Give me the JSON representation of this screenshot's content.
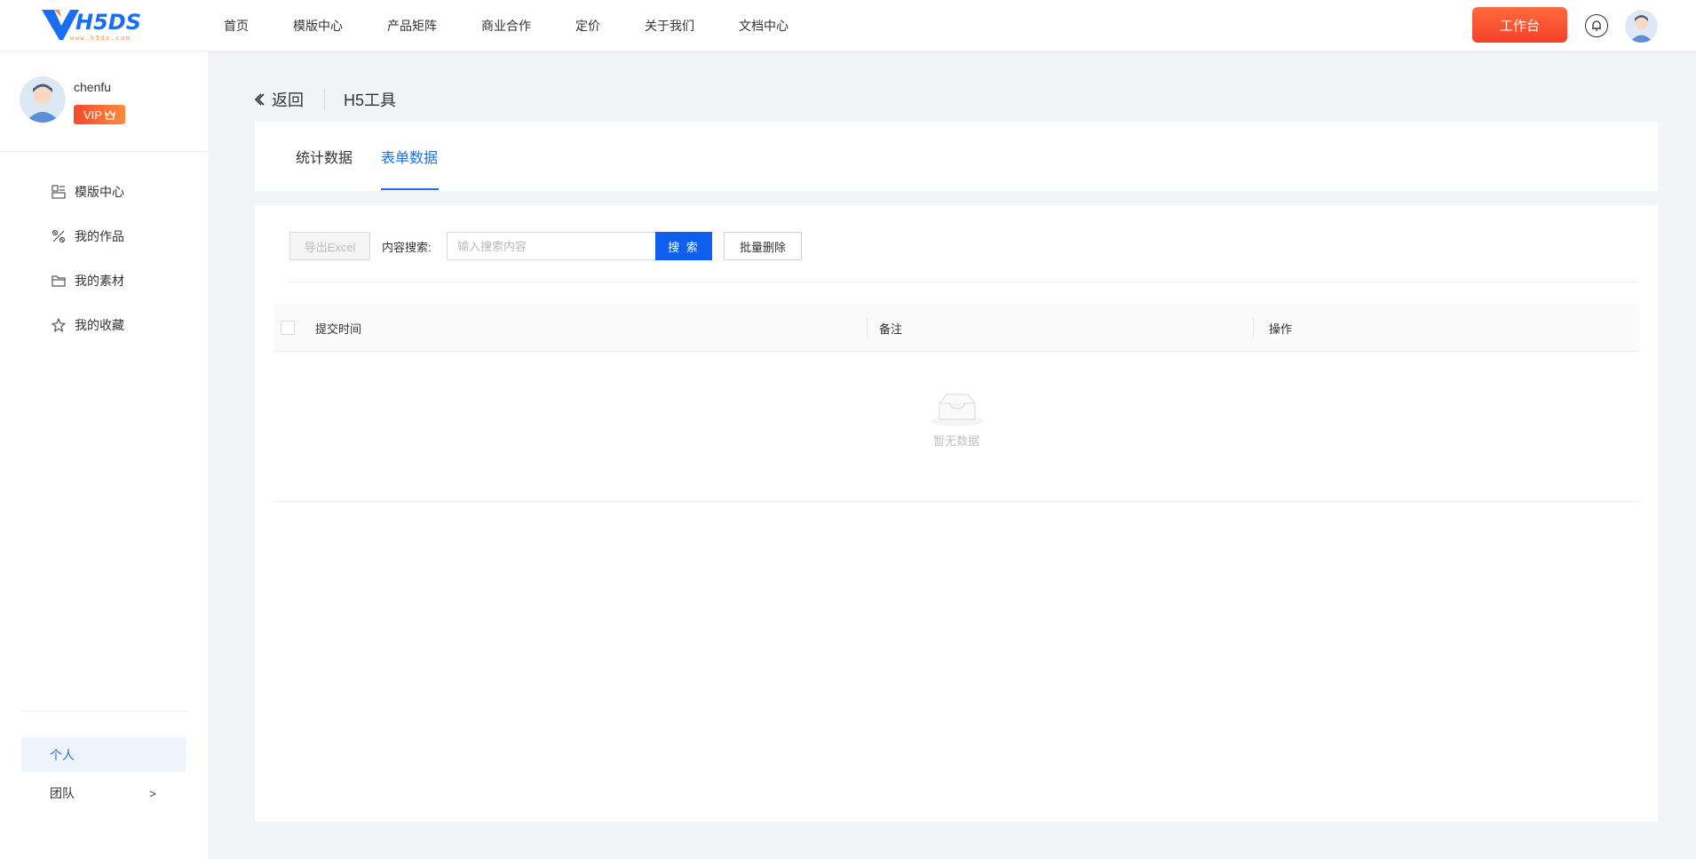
{
  "brand": {
    "logo_text": "VH5DS",
    "logo_sub": "www.h5ds.com",
    "accent": "#1a6ef2",
    "orange": "#f5412b"
  },
  "nav": {
    "items": [
      "首页",
      "模版中心",
      "产品矩阵",
      "商业合作",
      "定价",
      "关于我们",
      "文档中心"
    ],
    "workbench_label": "工作台",
    "icons": [
      "bell-icon",
      "avatar"
    ]
  },
  "sidebar": {
    "username": "chenfu",
    "vip_label": "VIP",
    "items": [
      {
        "label": "模版中心",
        "icon": "template-icon"
      },
      {
        "label": "我的作品",
        "icon": "works-icon"
      },
      {
        "label": "我的素材",
        "icon": "folder-icon"
      },
      {
        "label": "我的收藏",
        "icon": "star-icon"
      }
    ],
    "personal_label": "个人",
    "team_label": "团队",
    "team_chevron": ">"
  },
  "header": {
    "back_label": "返回",
    "title": "H5工具"
  },
  "tabs": [
    {
      "label": "统计数据",
      "active": false
    },
    {
      "label": "表单数据",
      "active": true
    }
  ],
  "toolbar": {
    "export_label": "导出Excel",
    "search_label": "内容搜索:",
    "search_placeholder": "输入搜索内容",
    "search_value": "",
    "search_button": "搜 索",
    "batch_delete_label": "批量删除"
  },
  "table": {
    "columns": [
      "提交时间",
      "备注",
      "操作"
    ],
    "rows": [],
    "empty_text": "暂无数据"
  }
}
